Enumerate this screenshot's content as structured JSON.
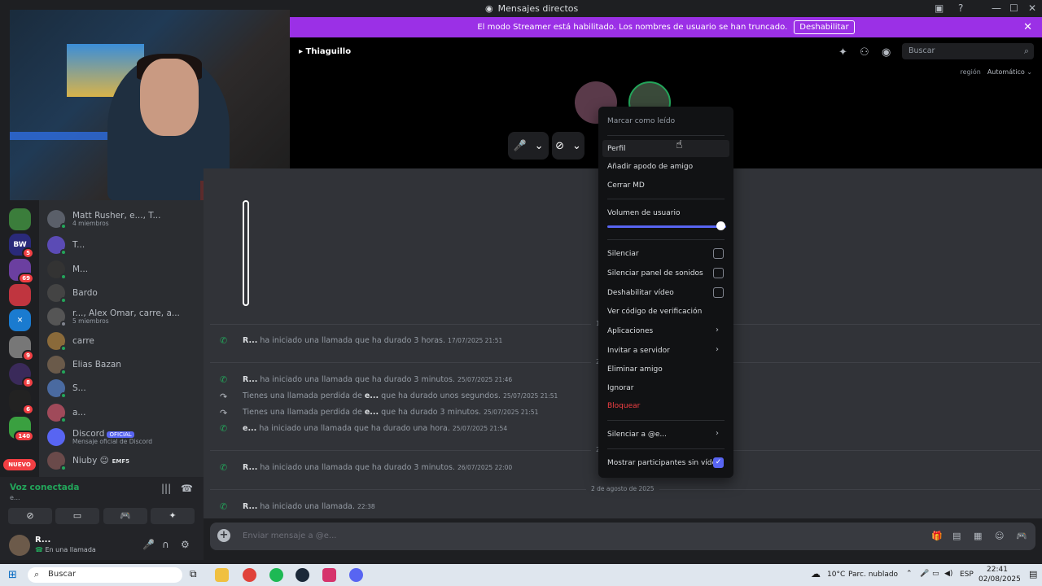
{
  "window": {
    "title": "Mensajes directos"
  },
  "banner": {
    "text": "El modo Streamer está habilitado. Los nombres de usuario se han truncado.",
    "button": "Deshabilitar"
  },
  "header": {
    "channel_name": "Thiaguillo",
    "search_placeholder": "Buscar"
  },
  "call": {
    "region_label": "región",
    "region_value": "Automático"
  },
  "rail": {
    "badges": [
      "5",
      "69",
      "9",
      "8",
      "6",
      "140"
    ],
    "new_label": "NUEVO"
  },
  "dm_list": [
    {
      "name": "Matt Rusher, e..., T...",
      "sub": "4 miembros"
    },
    {
      "name": "T...",
      "sub": ""
    },
    {
      "name": "M...",
      "sub": ""
    },
    {
      "name": "Bardo",
      "sub": ""
    },
    {
      "name": "r..., Alex Omar, carre, a...",
      "sub": "5 miembros"
    },
    {
      "name": "carre",
      "sub": ""
    },
    {
      "name": "Elias Bazan",
      "sub": ""
    },
    {
      "name": "S...",
      "sub": ""
    },
    {
      "name": "a...",
      "sub": ""
    },
    {
      "name": "Discord",
      "sub": "Mensaje oficial de Discord",
      "tag": "OFICIAL"
    },
    {
      "name": "Niuby",
      "sub": "",
      "tag": "EMF5"
    }
  ],
  "voice": {
    "status": "Voz conectada",
    "sub": "e..."
  },
  "user": {
    "name": "R...",
    "status": "En una llamada"
  },
  "messages": [
    {
      "author": "R...",
      "text": "ha iniciado una llamada que ha durado 3 horas.",
      "time": "17/07/2025 21:51"
    },
    {
      "author": "R...",
      "text": "ha iniciado una llamada que ha durado 3 minutos.",
      "time": "25/07/2025 21:46"
    },
    {
      "pre": "Tienes una llamada perdida de",
      "author": "e...",
      "text": "que ha durado unos segundos.",
      "time": "25/07/2025 21:51"
    },
    {
      "pre": "Tienes una llamada perdida de",
      "author": "e...",
      "text": "que ha durado 3 minutos.",
      "time": "25/07/2025 21:51"
    },
    {
      "author": "e...",
      "text": "ha iniciado una llamada que ha durado una hora.",
      "time": "25/07/2025 21:54"
    },
    {
      "author": "R...",
      "text": "ha iniciado una llamada que ha durado 3 minutos.",
      "time": "26/07/2025 22:00"
    },
    {
      "author": "R...",
      "text": "ha iniciado una llamada.",
      "time": "22:38"
    }
  ],
  "date_dividers": [
    "17",
    "25",
    "26",
    "2 de agosto de 2025"
  ],
  "composer": {
    "placeholder": "Enviar mensaje a @e..."
  },
  "context_menu": {
    "mark_read": "Marcar como leído",
    "profile": "Perfil",
    "add_nickname": "Añadir apodo de amigo",
    "close_dm": "Cerrar MD",
    "user_volume": "Volumen de usuario",
    "user_volume_level": 1.0,
    "mute": "Silenciar",
    "mute_soundboard": "Silenciar panel de sonidos",
    "disable_video": "Deshabilitar vídeo",
    "verify_code": "Ver código de verificación",
    "apps": "Aplicaciones",
    "invite_server": "Invitar a servidor",
    "remove_friend": "Eliminar amigo",
    "ignore": "Ignorar",
    "block": "Bloquear",
    "mute_user": "Silenciar a @e...",
    "show_participants": "Mostrar participantes sin vídeo"
  },
  "taskbar": {
    "search": "Buscar",
    "weather": "10°C",
    "weather_desc": "Parc. nublado",
    "lang": "ESP",
    "time": "22:41",
    "date": "02/08/2025"
  }
}
